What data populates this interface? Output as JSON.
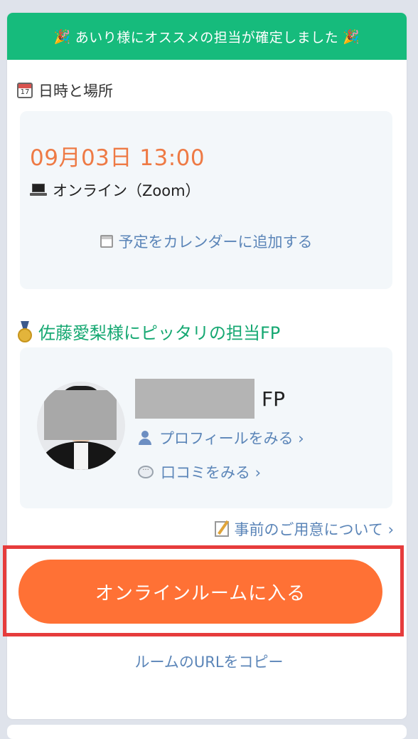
{
  "banner": {
    "text": "あいり様にオススメの担当が確定しました",
    "icon": "party-popper-icon"
  },
  "schedule": {
    "section_label": "日時と場所",
    "calendar_icon_day": "17",
    "date_time": "09月03日 13:00",
    "place": "オンライン（Zoom）",
    "add_to_calendar": "予定をカレンダーに追加する"
  },
  "fp": {
    "heading": "佐藤愛梨様にピッタリの担当FP",
    "name_suffix": "FP",
    "profile_link": "プロフィールをみる ›",
    "reviews_link": "口コミをみる ›"
  },
  "prep_link": "事前のご用意について ›",
  "enter_button": "オンラインルームに入る",
  "copy_url": "ルームのURLをコピー",
  "colors": {
    "banner": "#16bb7c",
    "accent_orange": "#ff7135",
    "link_blue": "#5b85b8",
    "highlight_red": "#e63c3c"
  }
}
